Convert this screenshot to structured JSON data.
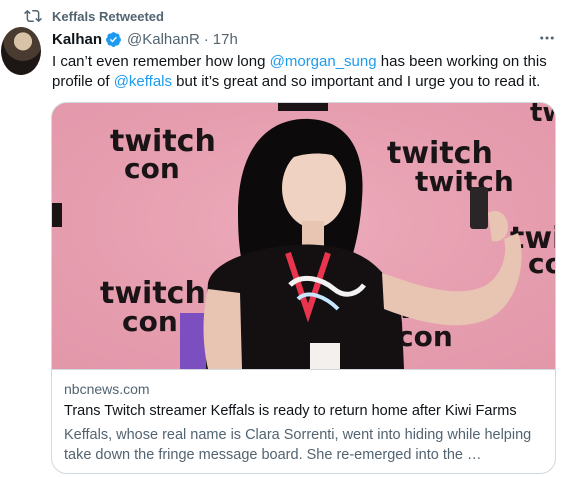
{
  "retweet": {
    "icon": "retweet-icon",
    "label": "Keffals Retweeted"
  },
  "author": {
    "name": "Kalhan",
    "handle": "@KalhanR",
    "separator": "·",
    "time": "17h",
    "verified_color": "#1d9bf0"
  },
  "tweet": {
    "t1": "I can’t even remember how long ",
    "m1": "@morgan_sung",
    "t2": " has been working on this profile of ",
    "m2": "@keffals",
    "t3": " but it’s great and so important and I urge you to read it."
  },
  "card": {
    "image_alt": "Person taking a selfie at a TwitchCon backdrop",
    "backdrop_word1": "twitch",
    "backdrop_word2": "con",
    "domain": "nbcnews.com",
    "title": "Trans Twitch streamer Keffals is ready to return home after Kiwi Farms",
    "description": "Keffals, whose real name is Clara Sorrenti, went into hiding while helping take down the fringe message board. She re-emerged into the …"
  },
  "colors": {
    "accent": "#1d9bf0",
    "muted": "#536471",
    "text": "#0f1419",
    "backdrop_pink": "#e9a3b4"
  }
}
